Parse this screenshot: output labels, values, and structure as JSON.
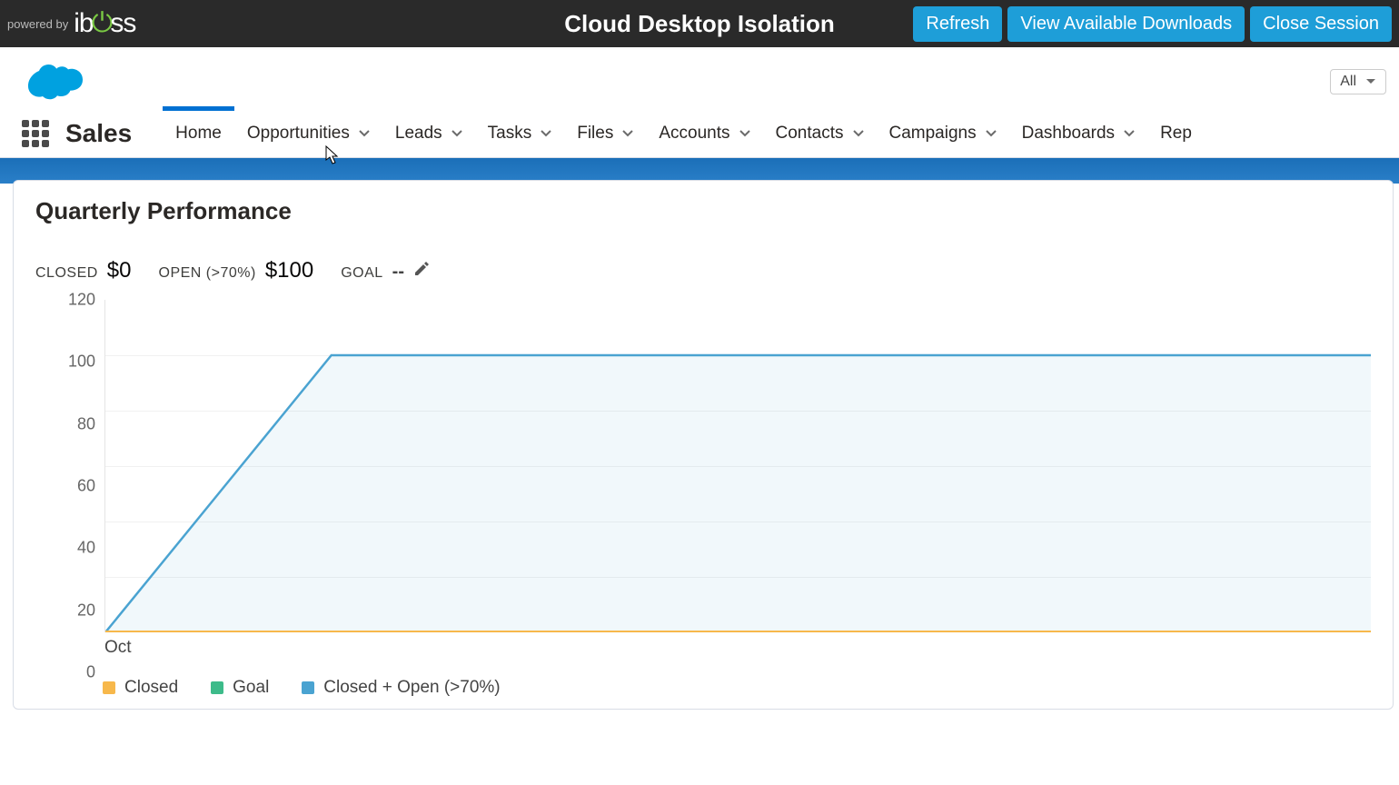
{
  "iboss": {
    "powered_by": "powered by",
    "brand": "iboss",
    "title": "Cloud Desktop Isolation",
    "buttons": {
      "refresh": "Refresh",
      "downloads": "View Available Downloads",
      "close": "Close Session"
    }
  },
  "sf": {
    "app_name": "Sales",
    "search_scope": "All",
    "nav": {
      "home": "Home",
      "opportunities": "Opportunities",
      "leads": "Leads",
      "tasks": "Tasks",
      "files": "Files",
      "accounts": "Accounts",
      "contacts": "Contacts",
      "campaigns": "Campaigns",
      "dashboards": "Dashboards",
      "reports": "Rep"
    }
  },
  "card": {
    "title": "Quarterly Performance",
    "metrics": {
      "closed_label": "CLOSED",
      "closed_value": "$0",
      "open_label": "OPEN (>70%)",
      "open_value": "$100",
      "goal_label": "GOAL",
      "goal_value": "--"
    },
    "legend": {
      "closed": "Closed",
      "goal": "Goal",
      "closed_open": "Closed + Open (>70%)"
    },
    "xaxis": {
      "oct": "Oct"
    },
    "colors": {
      "closed": "#f7b84b",
      "goal": "#3dbb8a",
      "closed_open": "#4aa3d1"
    }
  },
  "chart_data": {
    "type": "area",
    "title": "Quarterly Performance",
    "xlabel": "",
    "ylabel": "",
    "ylim": [
      0,
      120
    ],
    "y_ticks": [
      0,
      20,
      40,
      60,
      80,
      100,
      120
    ],
    "x_categories": [
      "Oct"
    ],
    "series": [
      {
        "name": "Closed",
        "color": "#f7b84b",
        "values": [
          0,
          0
        ]
      },
      {
        "name": "Goal",
        "color": "#3dbb8a",
        "values": [
          null,
          null
        ]
      },
      {
        "name": "Closed + Open (>70%)",
        "color": "#4aa3d1",
        "values": [
          0,
          100
        ]
      }
    ],
    "legend_position": "bottom"
  }
}
